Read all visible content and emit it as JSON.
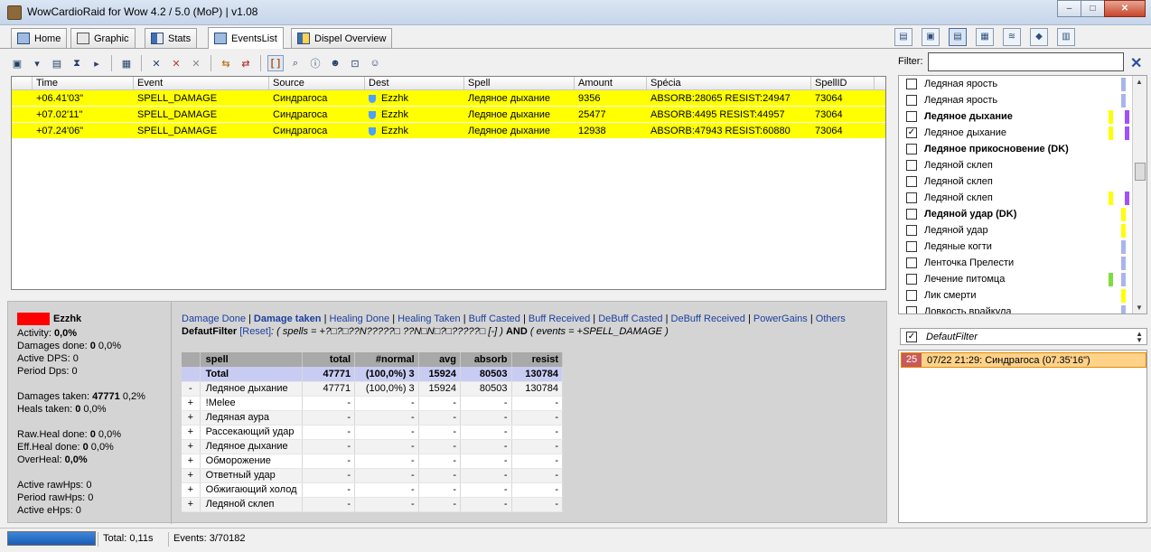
{
  "window": {
    "title": "WowCardioRaid for Wow 4.2 / 5.0 (MoP) | v1.08",
    "minimize": "–",
    "maximize": "□",
    "close": "✕"
  },
  "tabs": [
    {
      "label": "Home"
    },
    {
      "label": "Graphic"
    },
    {
      "label": "Stats"
    },
    {
      "label": "EventsList"
    },
    {
      "label": "Dispel Overview"
    }
  ],
  "events": {
    "columns": [
      "",
      "Time",
      "Event",
      "Source",
      "Dest",
      "Spell",
      "Amount",
      "Spécia",
      "SpellID"
    ],
    "rows": [
      {
        "time": "+06.41'03\"",
        "event": "SPELL_DAMAGE",
        "source": "Синдрагоса",
        "dest": "Ezzhk",
        "spell": "Ледяное дыхание",
        "amount": "9356",
        "specia": "ABSORB:28065 RESIST:24947",
        "spellid": "73064"
      },
      {
        "time": "+07.02'11\"",
        "event": "SPELL_DAMAGE",
        "source": "Синдрагоса",
        "dest": "Ezzhk",
        "spell": "Ледяное дыхание",
        "amount": "25477",
        "specia": "ABSORB:4495 RESIST:44957",
        "spellid": "73064"
      },
      {
        "time": "+07.24'06\"",
        "event": "SPELL_DAMAGE",
        "source": "Синдрагоса",
        "dest": "Ezzhk",
        "spell": "Ледяное дыхание",
        "amount": "12938",
        "specia": "ABSORB:47943 RESIST:60880",
        "spellid": "73064"
      }
    ]
  },
  "summary": {
    "player": "Ezzhk",
    "player_color": "#ff0000",
    "activity_label": "Activity:",
    "activity": "0,0%",
    "dmg_done_label": "Damages done:",
    "dmg_done": "0",
    "dmg_done_pct": "0,0%",
    "active_dps": "Active DPS: 0",
    "period_dps": "Period Dps: 0",
    "dmg_taken_label": "Damages taken:",
    "dmg_taken": "47771",
    "dmg_taken_pct": "0,2%",
    "heals_taken_label": "Heals taken:",
    "heals_taken": "0",
    "heals_taken_pct": "0,0%",
    "raw_heal_label": "Raw.Heal done:",
    "raw_heal": "0",
    "raw_heal_pct": "0,0%",
    "eff_heal_label": "Eff.Heal done:",
    "eff_heal": "0",
    "eff_heal_pct": "0,0%",
    "overheal_label": "OverHeal:",
    "overheal": "0,0%",
    "active_rawhps": "Active rawHps: 0",
    "period_rawhps": "Period rawHps: 0",
    "active_ehps": "Active eHps: 0"
  },
  "links": {
    "damage_done": "Damage Done",
    "damage_taken": "Damage taken",
    "healing_done": "Healing Done",
    "healing_taken": "Healing Taken",
    "buff_casted": "Buff Casted",
    "buff_received": "Buff Received",
    "debuff_casted": "DeBuff Casted",
    "debuff_received": "DeBuff Received",
    "powergains": "PowerGains",
    "others": "Others"
  },
  "filterline": {
    "name": "DefautFilter",
    "reset": "[Reset]",
    "expr1": ": ( spells = +?□?□??N?????□ ??N□N□?□?????□ [-] )",
    "and": "AND",
    "expr2": "( events = +SPELL_DAMAGE )"
  },
  "spelltable": {
    "headers": [
      "spell",
      "total",
      "#normal",
      "avg",
      "absorb",
      "resist"
    ],
    "total": {
      "label": "Total",
      "total": "47771",
      "normal": "(100,0%)  3",
      "avg": "15924",
      "absorb": "80503",
      "resist": "130784"
    },
    "rows": [
      {
        "pm": "-",
        "spell": "Ледяное дыхание",
        "total": "47771",
        "normal": "(100,0%)  3",
        "avg": "15924",
        "absorb": "80503",
        "resist": "130784"
      },
      {
        "pm": "+",
        "spell": "!Melee",
        "total": "-",
        "normal": "-",
        "avg": "-",
        "absorb": "-",
        "resist": "-"
      },
      {
        "pm": "+",
        "spell": "Ледяная аура",
        "total": "-",
        "normal": "-",
        "avg": "-",
        "absorb": "-",
        "resist": "-"
      },
      {
        "pm": "+",
        "spell": "Рассекающий удар",
        "total": "-",
        "normal": "-",
        "avg": "-",
        "absorb": "-",
        "resist": "-"
      },
      {
        "pm": "+",
        "spell": "Ледяное дыхание",
        "total": "-",
        "normal": "-",
        "avg": "-",
        "absorb": "-",
        "resist": "-"
      },
      {
        "pm": "+",
        "spell": "Обморожение",
        "total": "-",
        "normal": "-",
        "avg": "-",
        "absorb": "-",
        "resist": "-"
      },
      {
        "pm": "+",
        "spell": "Ответный удар",
        "total": "-",
        "normal": "-",
        "avg": "-",
        "absorb": "-",
        "resist": "-"
      },
      {
        "pm": "+",
        "spell": "Обжигающий холод",
        "total": "-",
        "normal": "-",
        "avg": "-",
        "absorb": "-",
        "resist": "-"
      },
      {
        "pm": "+",
        "spell": "Ледяной склеп",
        "total": "-",
        "normal": "-",
        "avg": "-",
        "absorb": "-",
        "resist": "-"
      }
    ]
  },
  "statusbar": {
    "progress_pct": 100,
    "total": "Total: 0,11s",
    "events": "Events: 3/70182"
  },
  "filter": {
    "label": "Filter:",
    "value": ""
  },
  "spelllist": [
    {
      "label": "Ледяная ярость",
      "bold": false,
      "checked": false,
      "bars": [
        "#aab4ee"
      ]
    },
    {
      "label": "Ледяная ярость",
      "bold": false,
      "checked": false,
      "bars": [
        "#aab4ee"
      ]
    },
    {
      "label": "Ледяное дыхание",
      "bold": true,
      "checked": false,
      "bars": [
        "#ffff00",
        "#a050ff"
      ]
    },
    {
      "label": "Ледяное дыхание",
      "bold": false,
      "checked": true,
      "bars": [
        "#ffff00",
        "#a050ff"
      ]
    },
    {
      "label": "Ледяное прикосновение (DK)",
      "bold": true,
      "checked": false,
      "bars": []
    },
    {
      "label": "Ледяной склеп",
      "bold": false,
      "checked": false,
      "bars": []
    },
    {
      "label": "Ледяной склеп",
      "bold": false,
      "checked": false,
      "bars": []
    },
    {
      "label": "Ледяной склеп",
      "bold": false,
      "checked": false,
      "bars": [
        "#ffff00",
        "#a050ff"
      ]
    },
    {
      "label": "Ледяной удар (DK)",
      "bold": true,
      "checked": false,
      "bars": [
        "#ffff00"
      ]
    },
    {
      "label": "Ледяной удар",
      "bold": false,
      "checked": false,
      "bars": [
        "#ffff00"
      ]
    },
    {
      "label": "Ледяные когти",
      "bold": false,
      "checked": false,
      "bars": [
        "#aab4ee"
      ]
    },
    {
      "label": "Ленточка Прелести",
      "bold": false,
      "checked": false,
      "bars": [
        "#aab4ee"
      ]
    },
    {
      "label": "Лечение питомца",
      "bold": false,
      "checked": false,
      "bars": [
        "#80dd40",
        "#aab4ee"
      ]
    },
    {
      "label": "Лик смерти",
      "bold": false,
      "checked": false,
      "bars": [
        "#ffff00"
      ]
    },
    {
      "label": "Ловкость врайкула",
      "bold": false,
      "checked": false,
      "bars": [
        "#aab4ee"
      ]
    }
  ],
  "deffilter": {
    "label": "DefautFilter",
    "checked": true
  },
  "fight": {
    "number": "25",
    "label": "07/22  21:29: Синдрагоса (07.35'16\")"
  }
}
